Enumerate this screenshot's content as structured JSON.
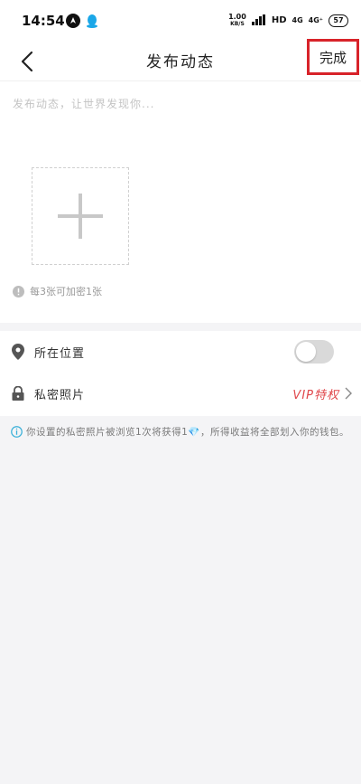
{
  "status_bar": {
    "time": "14:54",
    "net_speed_value": "1.00",
    "net_speed_unit": "KB/S",
    "hd_label": "HD",
    "network_1": "4G",
    "network_2": "4G⁺",
    "battery": "57"
  },
  "nav": {
    "title": "发布动态",
    "done_label": "完成"
  },
  "compose": {
    "placeholder": "发布动态，让世界发现你...",
    "hint": "每3张可加密1张"
  },
  "settings": {
    "location_label": "所在位置",
    "location_enabled": false,
    "private_photo_label": "私密照片",
    "vip_label": "VIP特权"
  },
  "notice": {
    "text_before": "你设置的私密照片被浏览1次将获得1",
    "gem": "💎",
    "text_after": "，所得收益将全部划入你的钱包。"
  },
  "colors": {
    "highlight_border": "#d8232a",
    "vip_text": "#e0474b",
    "notice_icon": "#3ab0d8"
  }
}
